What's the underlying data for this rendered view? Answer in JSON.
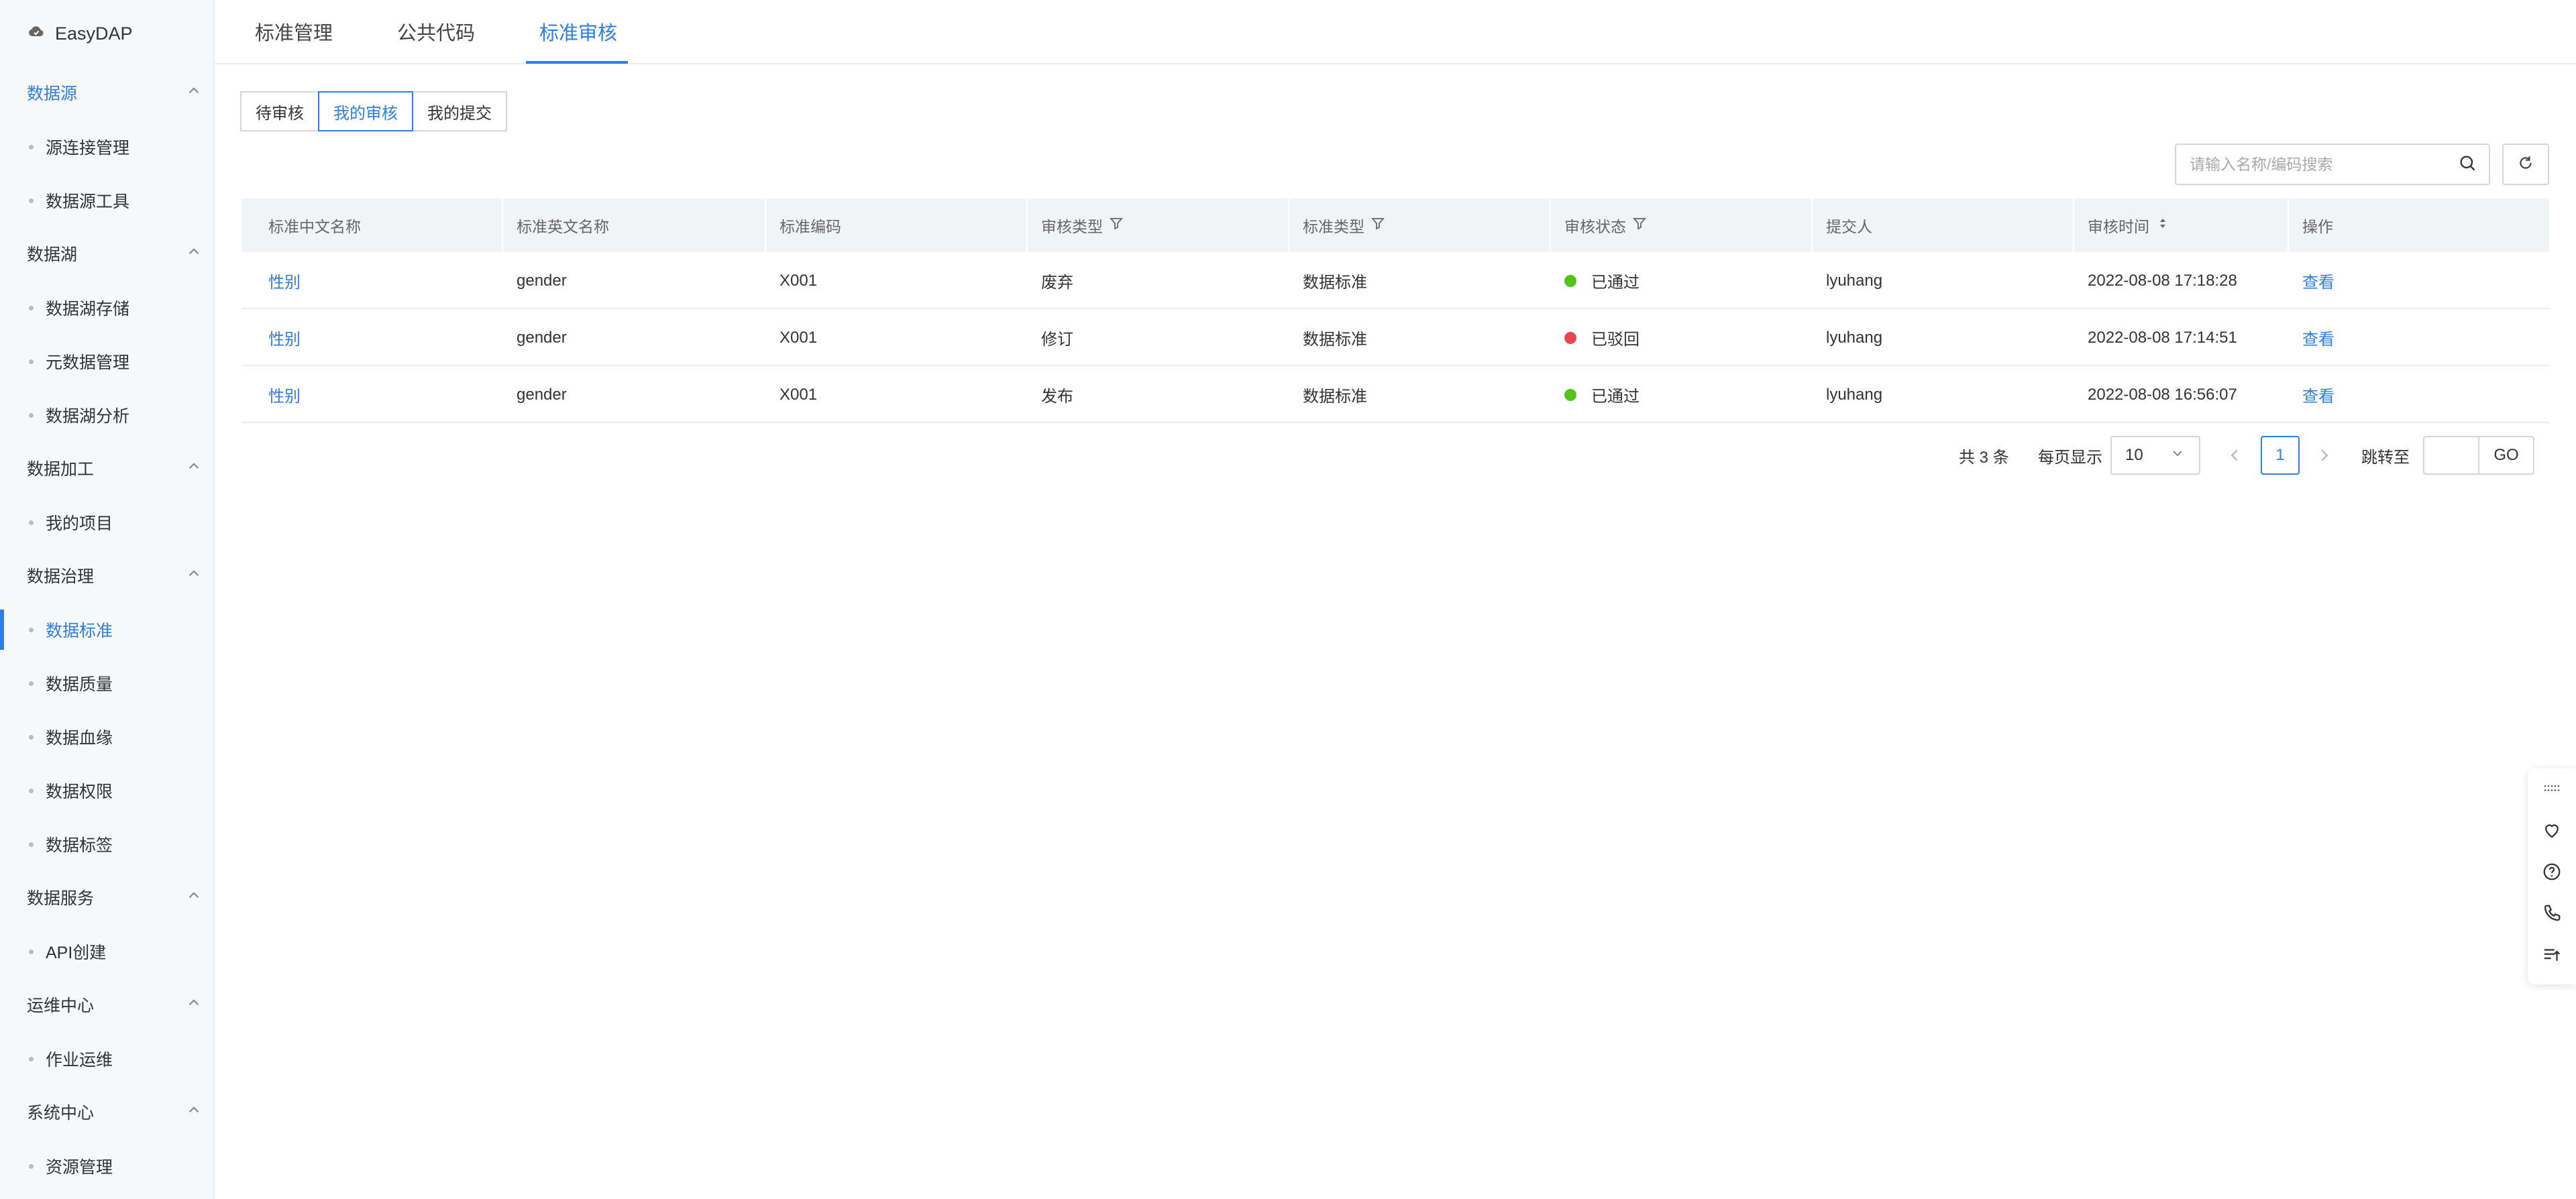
{
  "app": {
    "brand": "EasyDAP",
    "brand_icon": "cloud-icon"
  },
  "sidebar": {
    "groups": [
      {
        "title": "数据源",
        "active": true,
        "items": [
          "源连接管理",
          "数据源工具"
        ]
      },
      {
        "title": "数据湖",
        "items": [
          "数据湖存储",
          "元数据管理",
          "数据湖分析"
        ]
      },
      {
        "title": "数据加工",
        "items": [
          "我的项目"
        ]
      },
      {
        "title": "数据治理",
        "items": [
          "数据标准",
          "数据质量",
          "数据血缘",
          "数据权限",
          "数据标签"
        ]
      },
      {
        "title": "数据服务",
        "items": [
          "API创建"
        ]
      },
      {
        "title": "运维中心",
        "items": [
          "作业运维"
        ]
      },
      {
        "title": "系统中心",
        "items": [
          "资源管理"
        ]
      }
    ],
    "active_item": "数据标准"
  },
  "top_tabs": [
    "标准管理",
    "公共代码",
    "标准审核"
  ],
  "active_top_tab": "标准审核",
  "sub_tabs": [
    "待审核",
    "我的审核",
    "我的提交"
  ],
  "active_sub_tab": "我的审核",
  "search": {
    "placeholder": "请输入名称/编码搜索"
  },
  "table": {
    "columns": [
      "标准中文名称",
      "标准英文名称",
      "标准编码",
      "审核类型",
      "标准类型",
      "审核状态",
      "提交人",
      "审核时间",
      "操作"
    ],
    "rows": [
      {
        "cn_name": "性别",
        "en_name": "gender",
        "code": "X001",
        "review_type": "废弃",
        "std_type": "数据标准",
        "status": "已通过",
        "status_color": "#52c41a",
        "submitter": "lyuhang",
        "time": "2022-08-08 17:18:28",
        "action": "查看"
      },
      {
        "cn_name": "性别",
        "en_name": "gender",
        "code": "X001",
        "review_type": "修订",
        "std_type": "数据标准",
        "status": "已驳回",
        "status_color": "#e5484d",
        "submitter": "lyuhang",
        "time": "2022-08-08 17:14:51",
        "action": "查看"
      },
      {
        "cn_name": "性别",
        "en_name": "gender",
        "code": "X001",
        "review_type": "发布",
        "std_type": "数据标准",
        "status": "已通过",
        "status_color": "#52c41a",
        "submitter": "lyuhang",
        "time": "2022-08-08 16:56:07",
        "action": "查看"
      }
    ]
  },
  "pagination": {
    "total_text": "共 3 条",
    "page_size_label": "每页显示",
    "page_size": "10",
    "current_page": "1",
    "jump_label": "跳转至",
    "go_label": "GO"
  },
  "colors": {
    "accent": "#2f7fe0",
    "sidebar_bg": "#f7f8fa",
    "header_bg": "#f2f3f5"
  },
  "float_toolbar": [
    "drag-handle-icon",
    "heart-icon",
    "help-icon",
    "phone-icon",
    "back-to-top-icon"
  ]
}
